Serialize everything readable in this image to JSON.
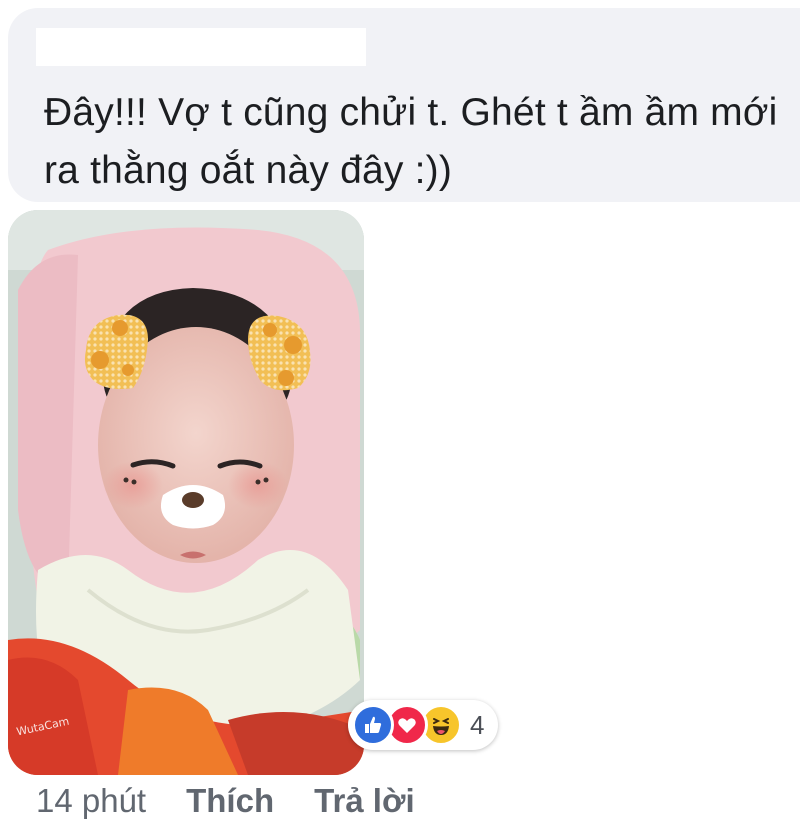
{
  "comment": {
    "text": "Đây!!! Vợ t cũng chửi t. Ghét t ầm ầm mới ra thằng oắt này đây :))"
  },
  "photo": {
    "watermark": "WutaCam"
  },
  "reactions": {
    "icons": [
      "like-icon",
      "love-icon",
      "haha-icon"
    ],
    "colors": {
      "like": "#2f6ddc",
      "love": "#f0284a",
      "haha": "#f7c52b"
    },
    "count": "4"
  },
  "actions": {
    "time": "14 phút",
    "like_label": "Thích",
    "reply_label": "Trả lời"
  }
}
